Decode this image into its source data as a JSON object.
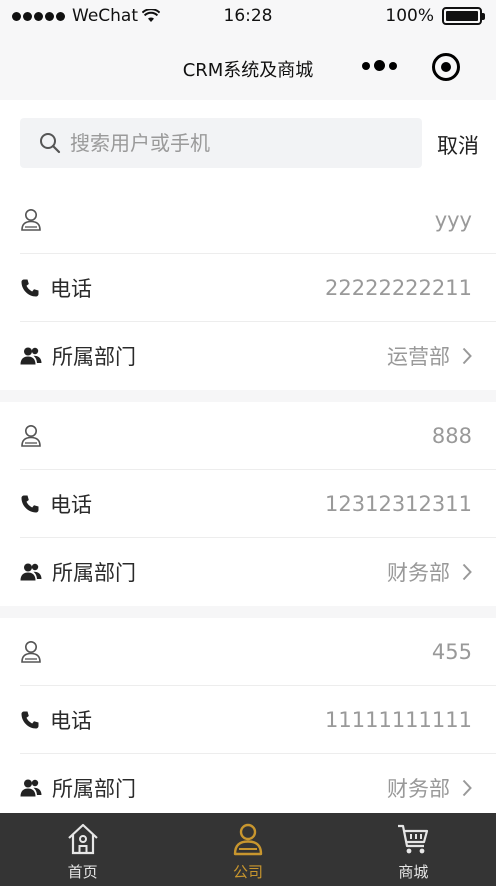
{
  "status_bar": {
    "carrier": "WeChat",
    "time": "16:28",
    "battery": "100%"
  },
  "nav": {
    "title": "CRM系统及商城"
  },
  "search": {
    "placeholder": "搜索用户或手机",
    "cancel_label": "取消"
  },
  "contacts": [
    {
      "name": "yyy",
      "phone_label": "电话",
      "phone": "22222222211",
      "dept_label": "所属部门",
      "dept": "运营部"
    },
    {
      "name": "888",
      "phone_label": "电话",
      "phone": "12312312311",
      "dept_label": "所属部门",
      "dept": "财务部"
    },
    {
      "name": "455",
      "phone_label": "电话",
      "phone": "11111111111",
      "dept_label": "所属部门",
      "dept": "财务部"
    }
  ],
  "tabbar": {
    "items": [
      {
        "label": "首页",
        "icon": "home-icon"
      },
      {
        "label": "公司",
        "icon": "company-user-icon"
      },
      {
        "label": "商城",
        "icon": "cart-icon"
      }
    ],
    "active_index": 1
  },
  "colors": {
    "accent": "#c8962e",
    "tabbar_bg": "#343434",
    "value_text": "#999999"
  }
}
